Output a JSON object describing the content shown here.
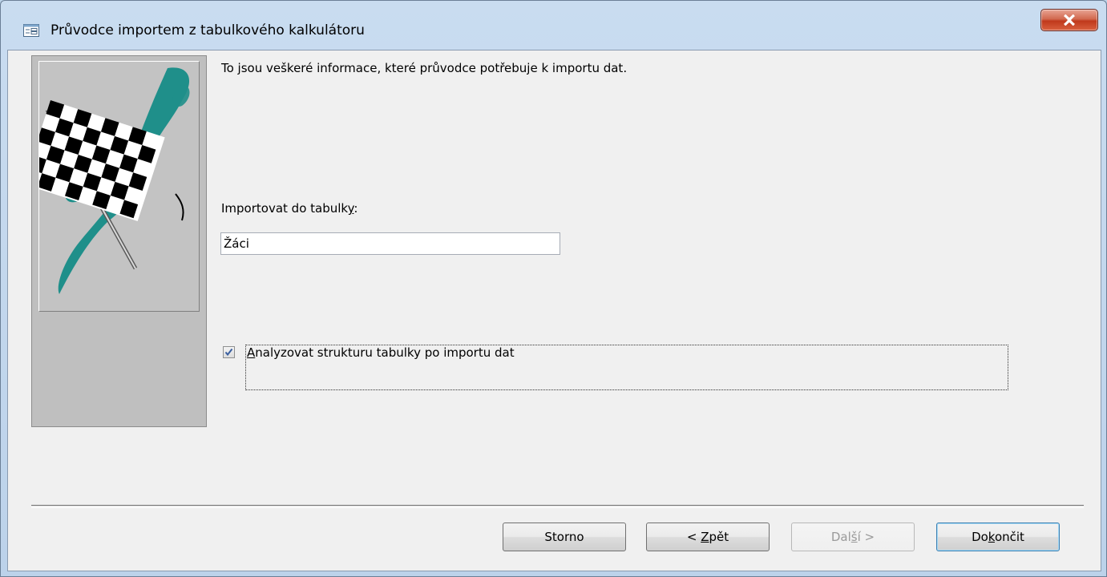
{
  "window": {
    "title": "Průvodce importem z tabulkového kalkulátoru",
    "close_label": "X"
  },
  "wizard": {
    "intro_text": "To jsou veškeré informace, které průvodce potřebuje k importu dat.",
    "table_label_prefix": "Importovat do tabulk",
    "table_label_accel": "y",
    "table_label_suffix": ":",
    "table_name_value": "Žáci",
    "analyze_checkbox": {
      "label_accel": "A",
      "label_rest": "nalyzovat strukturu tabulky po importu dat",
      "checked": true
    }
  },
  "buttons": {
    "cancel": "Storno",
    "back_prefix": "< ",
    "back_accel": "Z",
    "back_rest": "pět",
    "next_prefix": "Dal",
    "next_accel": "š",
    "next_rest": "í >",
    "finish_prefix": "Do",
    "finish_accel": "k",
    "finish_rest": "ončit"
  },
  "colors": {
    "dialog_bg": "#f0f0f0",
    "titlebar_bg": "#c9dcf0",
    "close_button": "#c0391c",
    "side_panel": "#bfbfbf",
    "flag_swoosh": "#1f8f8a",
    "check_mark": "#3a5f9f"
  },
  "icons": {
    "title": "form-window-icon",
    "close": "close-x-icon",
    "side_art": "checkered-flag-illustration",
    "check": "checkmark-icon"
  }
}
